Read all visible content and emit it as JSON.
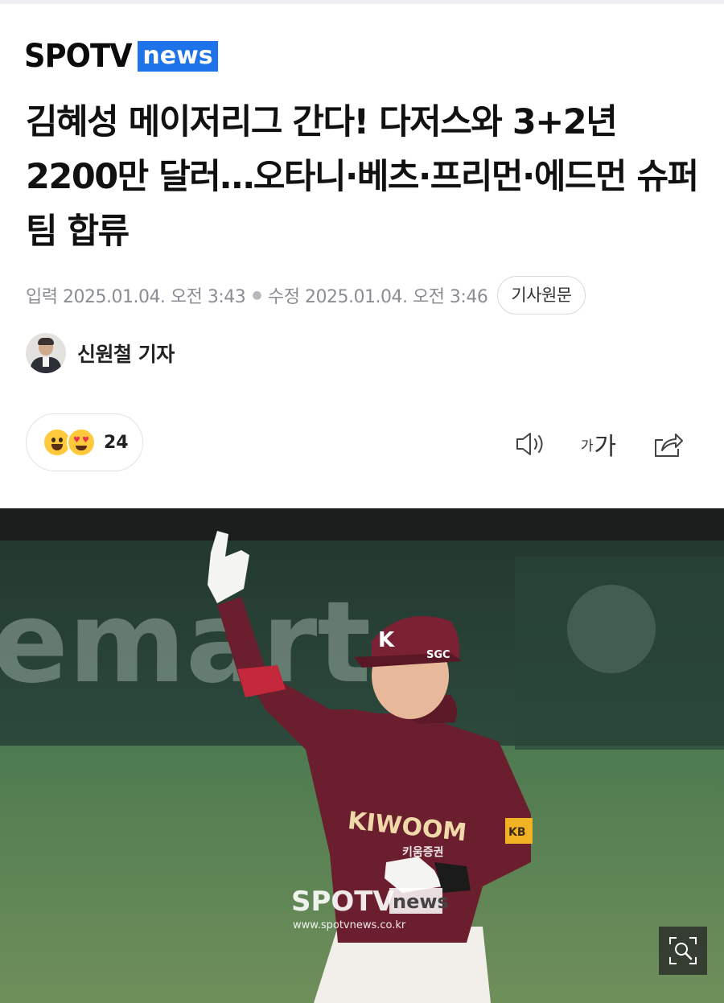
{
  "header": {
    "logo_main": "SPOTV",
    "logo_badge": "news"
  },
  "article": {
    "headline": "김혜성 메이저리그 간다! 다저스와 3+2년 2200만 달러…오타니·베츠·프리먼·에드먼 슈퍼팀 합류",
    "published": "입력 2025.01.04. 오전 3:43",
    "modified": "수정 2025.01.04. 오전 3:46",
    "original_button": "기사원문",
    "author": "신원철 기자"
  },
  "toolbar": {
    "reaction_count": "24",
    "font_small": "가",
    "font_large": "가",
    "icons": [
      "speaker-icon",
      "font-size-icon",
      "share-icon"
    ]
  },
  "photo": {
    "banner_text": "emart",
    "helmet_mark": "K",
    "helmet_sponsor": "SGC",
    "jersey_brand": "KIWOOM",
    "jersey_sub": "키움증권",
    "sleeve_patch": "KB",
    "watermark_brand": "SPOTV",
    "watermark_badge": "news",
    "watermark_url": "www.spotvnews.co.kr",
    "zoom_icon": "zoom-icon"
  },
  "colors": {
    "brand_blue": "#1e73e8",
    "meta_gray": "#8a8d93",
    "jersey_maroon": "#6b1f2e"
  }
}
